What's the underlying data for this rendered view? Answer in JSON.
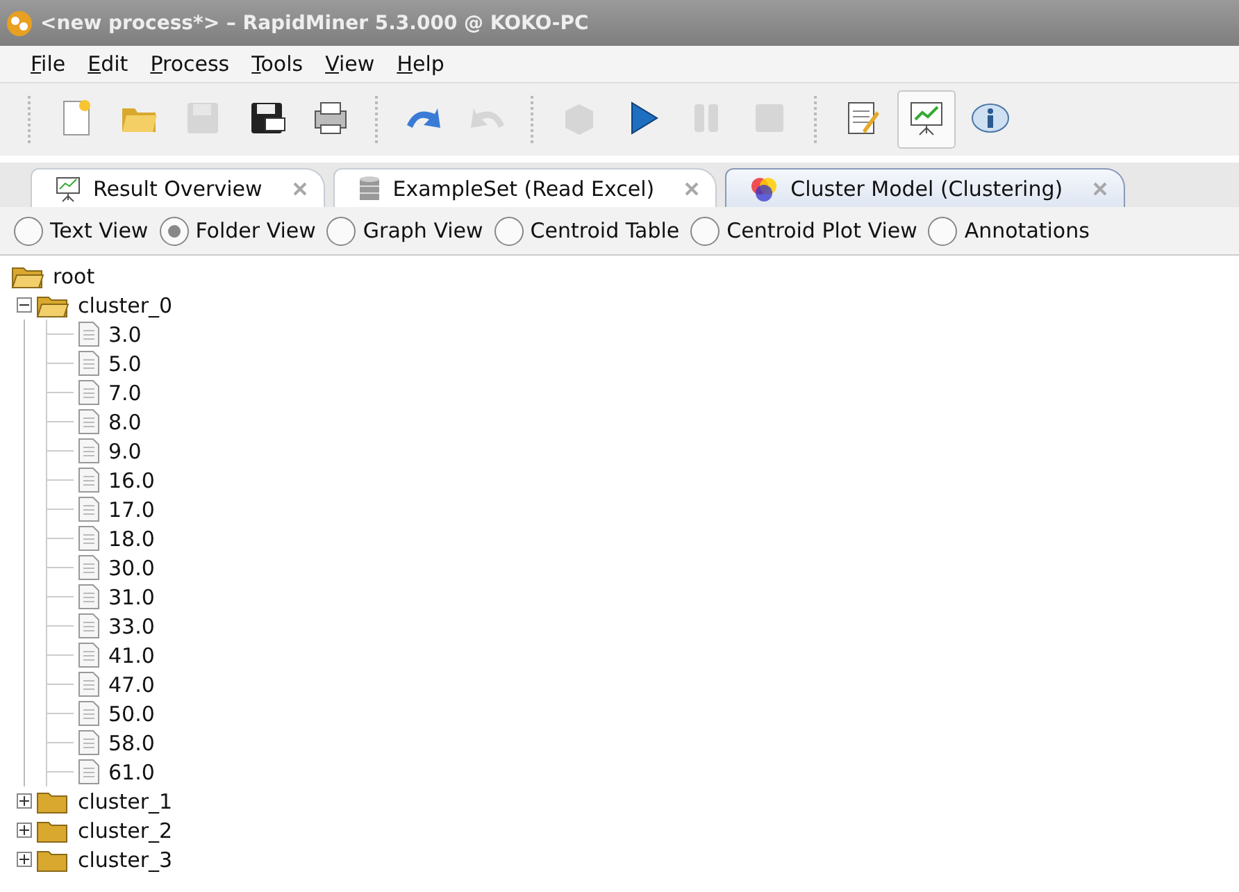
{
  "window": {
    "title": "<new process*> – RapidMiner 5.3.000 @ KOKO-PC"
  },
  "menu": [
    "File",
    "Edit",
    "Process",
    "Tools",
    "View",
    "Help"
  ],
  "toolbar": [
    [
      {
        "kind": "new",
        "disabled": false
      },
      {
        "kind": "open",
        "disabled": false
      },
      {
        "kind": "save",
        "disabled": true
      },
      {
        "kind": "save-as",
        "disabled": false
      },
      {
        "kind": "print",
        "disabled": false
      }
    ],
    [
      {
        "kind": "undo",
        "disabled": false
      },
      {
        "kind": "redo",
        "disabled": true
      }
    ],
    [
      {
        "kind": "cube",
        "disabled": true
      },
      {
        "kind": "play",
        "disabled": false
      },
      {
        "kind": "pause",
        "disabled": true
      },
      {
        "kind": "stop",
        "disabled": true
      }
    ],
    [
      {
        "kind": "notes",
        "disabled": false,
        "selected": false
      },
      {
        "kind": "chart",
        "disabled": false,
        "selected": true
      },
      {
        "kind": "info",
        "disabled": false,
        "selected": false
      }
    ]
  ],
  "tabs": [
    {
      "label": "Result Overview",
      "selected": false
    },
    {
      "label": "ExampleSet (Read Excel)",
      "selected": false
    },
    {
      "label": "Cluster Model (Clustering)",
      "selected": true
    }
  ],
  "views": [
    {
      "label": "Text View",
      "selected": false
    },
    {
      "label": "Folder View",
      "selected": true
    },
    {
      "label": "Graph View",
      "selected": false
    },
    {
      "label": "Centroid Table",
      "selected": false
    },
    {
      "label": "Centroid Plot View",
      "selected": false
    },
    {
      "label": "Annotations",
      "selected": false
    }
  ],
  "tree": {
    "label": "root",
    "children": [
      {
        "label": "cluster_0",
        "expanded": true,
        "children": [
          "3.0",
          "5.0",
          "7.0",
          "8.0",
          "9.0",
          "16.0",
          "17.0",
          "18.0",
          "30.0",
          "31.0",
          "33.0",
          "41.0",
          "47.0",
          "50.0",
          "58.0",
          "61.0"
        ]
      },
      {
        "label": "cluster_1",
        "expanded": false
      },
      {
        "label": "cluster_2",
        "expanded": false
      },
      {
        "label": "cluster_3",
        "expanded": false
      }
    ]
  }
}
